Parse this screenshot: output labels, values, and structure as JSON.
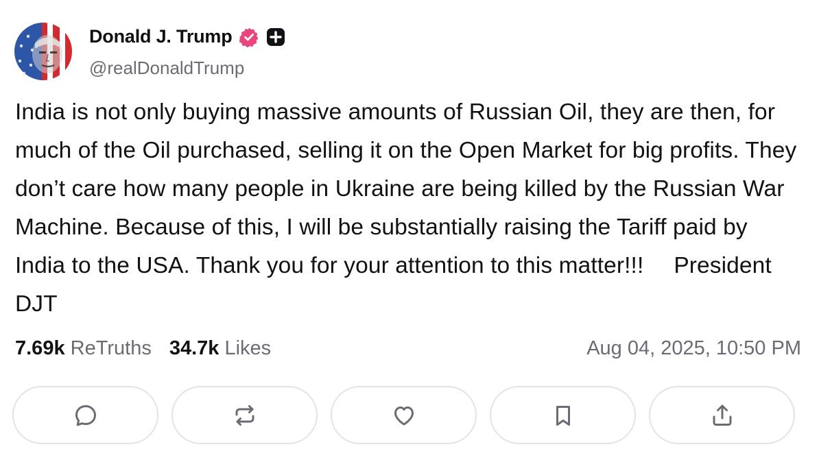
{
  "author": {
    "display_name": "Donald J. Trump",
    "handle": "@realDonaldTrump",
    "verified_icon": "verified-badge-icon",
    "plus_icon": "plus-badge-icon",
    "verified_color": "#e8467c"
  },
  "post": {
    "text": "India is not only buying massive amounts of Russian Oil, they are then, for much of the Oil purchased, selling it on the Open Market for big profits. They don’t care how many people in Ukraine are being killed by the Russian War Machine. Because of this, I will be substantially raising the Tariff paid by India to the USA. Thank you for your attention to this matter!!!",
    "signature": "President DJT"
  },
  "stats": {
    "retruths_count": "7.69k",
    "retruths_label": "ReTruths",
    "likes_count": "34.7k",
    "likes_label": "Likes",
    "timestamp": "Aug 04, 2025, 10:50 PM"
  },
  "actions": [
    {
      "name": "reply",
      "icon": "comment-icon"
    },
    {
      "name": "retruth",
      "icon": "retruth-icon"
    },
    {
      "name": "like",
      "icon": "heart-icon"
    },
    {
      "name": "bookmark",
      "icon": "bookmark-icon"
    },
    {
      "name": "share",
      "icon": "share-icon"
    }
  ],
  "colors": {
    "text": "#111116",
    "muted": "#6b6b76",
    "border": "#e3e3e8",
    "icon": "#6b6b76"
  }
}
